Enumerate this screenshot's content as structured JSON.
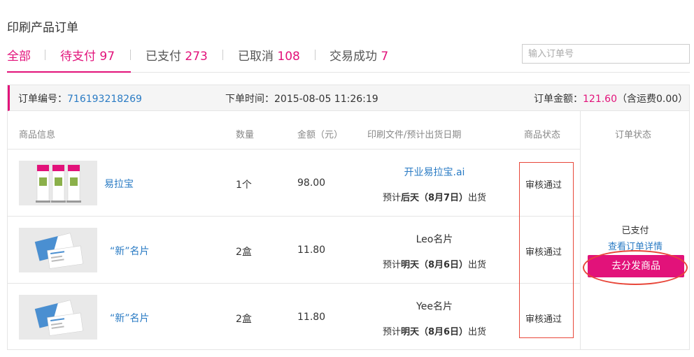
{
  "page": {
    "title": "印刷产品订单"
  },
  "tabs": [
    {
      "label": "全部",
      "count": ""
    },
    {
      "label": "待支付",
      "count": "97"
    },
    {
      "label": "已支付",
      "count": "273"
    },
    {
      "label": "已取消",
      "count": "108"
    },
    {
      "label": "交易成功",
      "count": "7"
    }
  ],
  "search": {
    "placeholder": "输入订单号"
  },
  "order": {
    "no_label": "订单编号：",
    "no": "716193218269",
    "time_label": "下单时间：",
    "time": "2015-08-05 11:26:19",
    "amount_label": "订单金额：",
    "amount": "121.60",
    "amount_note": "（含运费0.00）"
  },
  "columns": {
    "product": "商品信息",
    "qty": "数量",
    "amount": "金额（元）",
    "file": "印刷文件/预计出货日期",
    "item_status": "商品状态",
    "order_status": "订单状态"
  },
  "items": [
    {
      "name": "易拉宝",
      "qty": "1个",
      "price": "98.00",
      "file": "开业易拉宝.ai",
      "ship_pre": "预计",
      "ship_day": "后天（8月7日）",
      "ship_post": "出货",
      "status": "审核通过"
    },
    {
      "name": "“新”名片",
      "qty": "2盒",
      "price": "11.80",
      "file": "Leo名片",
      "ship_pre": "预计",
      "ship_day": "明天（8月6日）",
      "ship_post": "出货",
      "status": "审核通过"
    },
    {
      "name": "“新”名片",
      "qty": "2盒",
      "price": "11.80",
      "file": "Yee名片",
      "ship_pre": "预计",
      "ship_day": "明天（8月6日）",
      "ship_post": "出货",
      "status": "审核通过"
    }
  ],
  "order_status": {
    "paid": "已支付",
    "detail_link": "查看订单详情",
    "distribute_button": "去分发商品"
  },
  "colors": {
    "accent": "#e2127a",
    "link": "#2a7bc4",
    "annotation": "#e8473a"
  }
}
